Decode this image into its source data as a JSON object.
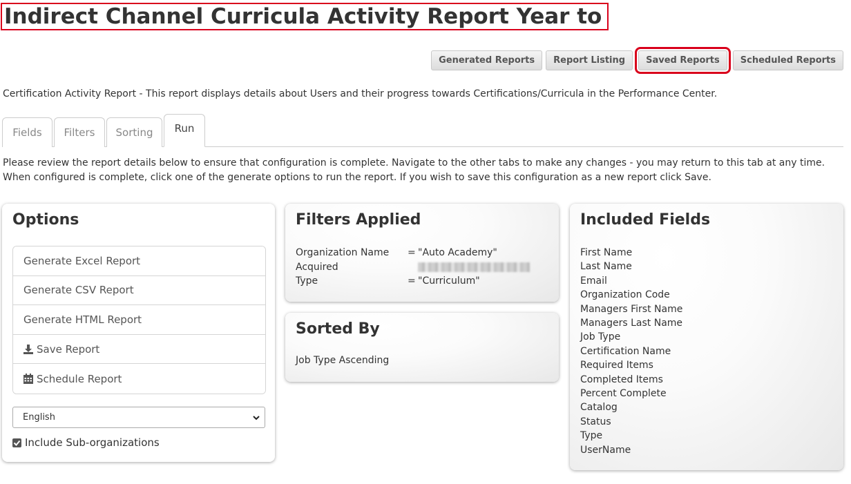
{
  "page": {
    "title": "Indirect Channel Curricula Activity Report Year to Date",
    "description": "Certification Activity Report - This report displays details about Users and their progress towards Certifications/Curricula in the Performance Center.",
    "instructions": "Please review the report details below to ensure that configuration is complete. Navigate to the other tabs to make any changes - you may return to this tab at any time. When configured is complete, click one of the generate options to run the report. If you wish to save this configuration as a new report click Save."
  },
  "top_buttons": {
    "generated": "Generated Reports",
    "listing": "Report Listing",
    "saved": "Saved Reports",
    "scheduled": "Scheduled Reports"
  },
  "tabs": {
    "fields": "Fields",
    "filters": "Filters",
    "sorting": "Sorting",
    "run": "Run",
    "active": "Run"
  },
  "options": {
    "title": "Options",
    "items": {
      "excel": "Generate Excel Report",
      "csv": "Generate CSV Report",
      "html": "Generate HTML Report",
      "save": "Save Report",
      "schedule": "Schedule Report"
    },
    "language_selected": "English",
    "include_sub_orgs_label": "Include Sub-organizations",
    "include_sub_orgs_checked": true
  },
  "filters": {
    "title": "Filters Applied",
    "rows": [
      {
        "name": "Organization Name",
        "op": "=",
        "value": "\"Auto Academy\""
      },
      {
        "name": "Acquired",
        "op": "",
        "value": ""
      },
      {
        "name": "Type",
        "op": "=",
        "value": "\"Curriculum\""
      }
    ]
  },
  "sorted": {
    "title": "Sorted By",
    "value": "Job Type Ascending"
  },
  "included": {
    "title": "Included Fields",
    "fields": [
      "First Name",
      "Last Name",
      "Email",
      "Organization Code",
      "Managers First Name",
      "Managers Last Name",
      "Job Type",
      "Certification Name",
      "Required Items",
      "Completed Items",
      "Percent Complete",
      "Catalog",
      "Status",
      "Type",
      "UserName"
    ]
  },
  "colors": {
    "highlight": "#d9001b",
    "text": "#333333",
    "muted": "#555555"
  }
}
